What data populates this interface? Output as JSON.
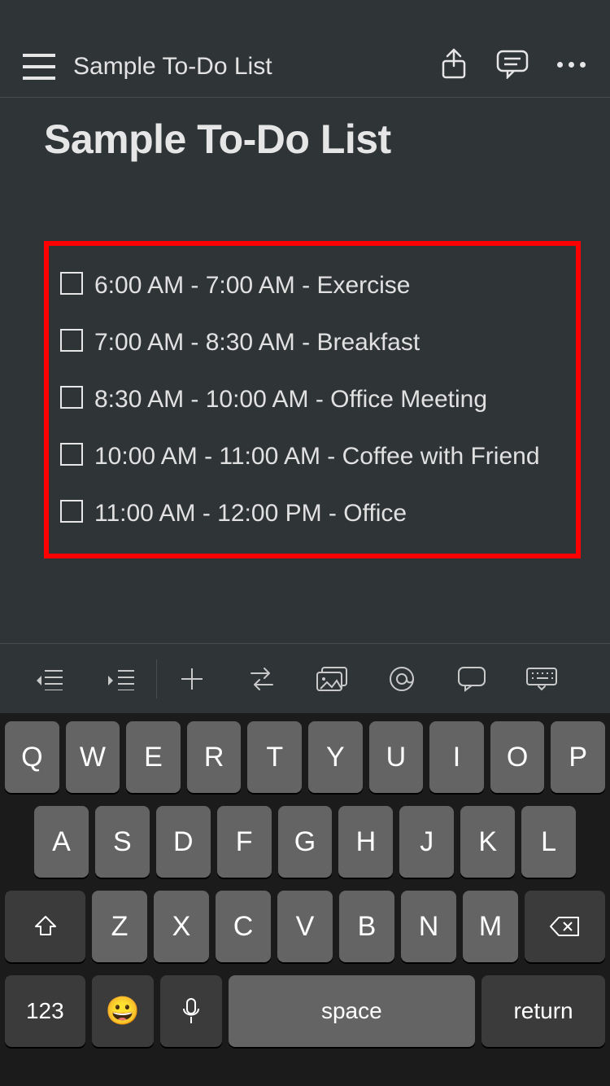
{
  "nav": {
    "title": "Sample To-Do List"
  },
  "page": {
    "title": "Sample To-Do List"
  },
  "todos": [
    {
      "text": "6:00 AM - 7:00 AM - Exercise"
    },
    {
      "text": "7:00 AM - 8:30 AM - Breakfast"
    },
    {
      "text": " 8:30 AM - 10:00 AM - Office Meeting"
    },
    {
      "text": "10:00 AM - 11:00 AM - Coffee with Friend"
    },
    {
      "text": "11:00 AM - 12:00 PM - Office"
    }
  ],
  "keyboard": {
    "row1": [
      "Q",
      "W",
      "E",
      "R",
      "T",
      "Y",
      "U",
      "I",
      "O",
      "P"
    ],
    "row2": [
      "A",
      "S",
      "D",
      "F",
      "G",
      "H",
      "J",
      "K",
      "L"
    ],
    "row3": [
      "Z",
      "X",
      "C",
      "V",
      "B",
      "N",
      "M"
    ],
    "numKey": "123",
    "spaceKey": "space",
    "returnKey": "return",
    "emoji": "😀"
  }
}
